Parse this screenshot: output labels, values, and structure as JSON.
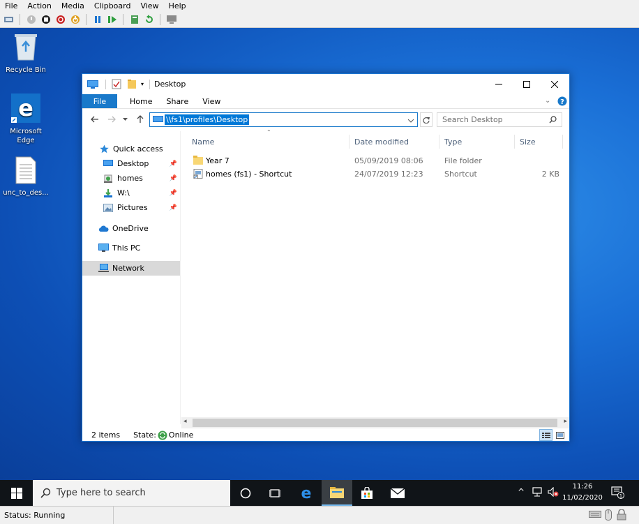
{
  "vm": {
    "menu": [
      "File",
      "Action",
      "Media",
      "Clipboard",
      "View",
      "Help"
    ],
    "status": "Status: Running"
  },
  "desktop": {
    "icons": [
      {
        "label": "Recycle Bin"
      },
      {
        "label": "Microsoft Edge"
      },
      {
        "label": "unc_to_des..."
      }
    ]
  },
  "explorer": {
    "title": "Desktop",
    "ribbon": {
      "file": "File",
      "tabs": [
        "Home",
        "Share",
        "View"
      ]
    },
    "address": "\\\\fs1\\profiles\\Desktop",
    "search_placeholder": "Search Desktop",
    "nav": {
      "quick_access": "Quick access",
      "items": [
        "Desktop",
        "homes",
        "W:\\",
        "Pictures"
      ],
      "onedrive": "OneDrive",
      "thispc": "This PC",
      "network": "Network"
    },
    "columns": [
      "Name",
      "Date modified",
      "Type",
      "Size"
    ],
    "files": [
      {
        "name": "Year 7",
        "date": "05/09/2019 08:06",
        "type": "File folder",
        "size": ""
      },
      {
        "name": "homes (fs1) - Shortcut",
        "date": "24/07/2019 12:23",
        "type": "Shortcut",
        "size": "2 KB"
      }
    ],
    "status": {
      "count": "2 items",
      "state_label": "State:",
      "state_value": "Online"
    }
  },
  "taskbar": {
    "search_placeholder": "Type here to search",
    "time": "11:26",
    "date": "11/02/2020"
  },
  "colors": {
    "accent": "#0078d7",
    "file_tab": "#1979ca",
    "taskbar": "#101418"
  }
}
